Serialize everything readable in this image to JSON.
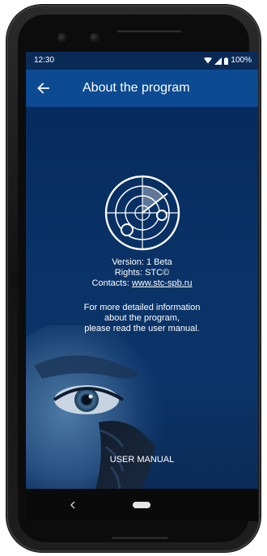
{
  "status_bar": {
    "time": "12:30",
    "battery": "100%",
    "icons": [
      "wifi-icon",
      "signal-icon",
      "battery-icon"
    ]
  },
  "app_bar": {
    "title": "About the program",
    "back_icon": "arrow-left-icon"
  },
  "about": {
    "version": "Version: 1 Beta",
    "rights": "Rights: STC©",
    "contacts_label": "Contacts: ",
    "contacts_link": "www.stc-spb.ru",
    "more_line1": "For more detailed information",
    "more_line2": "about the program,",
    "more_line3": "please read the user manual.",
    "manual_button": "USER MANUAL"
  },
  "nav_bar": {
    "back_icon": "nav-back-icon",
    "home_icon": "nav-home-pill"
  },
  "colors": {
    "app_bar": "#0c4a91",
    "screen_bg": "#0b2b57",
    "text": "#ffffff"
  }
}
